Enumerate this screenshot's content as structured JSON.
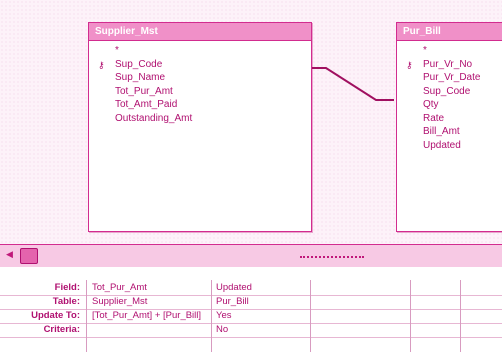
{
  "tables": [
    {
      "title": "Supplier_Mst",
      "fields": [
        "*",
        "Sup_Code",
        "Sup_Name",
        "Tot_Pur_Amt",
        "Tot_Amt_Paid",
        "Outstanding_Amt"
      ],
      "key_field_index": 1
    },
    {
      "title": "Pur_Bill",
      "fields": [
        "*",
        "Pur_Vr_No",
        "Pur_Vr_Date",
        "Sup_Code",
        "Qty",
        "Rate",
        "Bill_Amt",
        "Updated"
      ],
      "key_field_index": 1
    }
  ],
  "grid": {
    "row_labels": [
      "Field:",
      "Table:",
      "Update To:",
      "Criteria:"
    ],
    "columns": [
      {
        "field": "Tot_Pur_Amt",
        "table": "Supplier_Mst",
        "update_to": "[Tot_Pur_Amt] + [Pur_Bill]",
        "criteria": ""
      },
      {
        "field": "Updated",
        "table": "Pur_Bill",
        "update_to": "Yes",
        "criteria": "No"
      }
    ]
  },
  "colors": {
    "accent": "#d22c8f",
    "title_bar": "#f090c8",
    "text": "#b01070"
  }
}
